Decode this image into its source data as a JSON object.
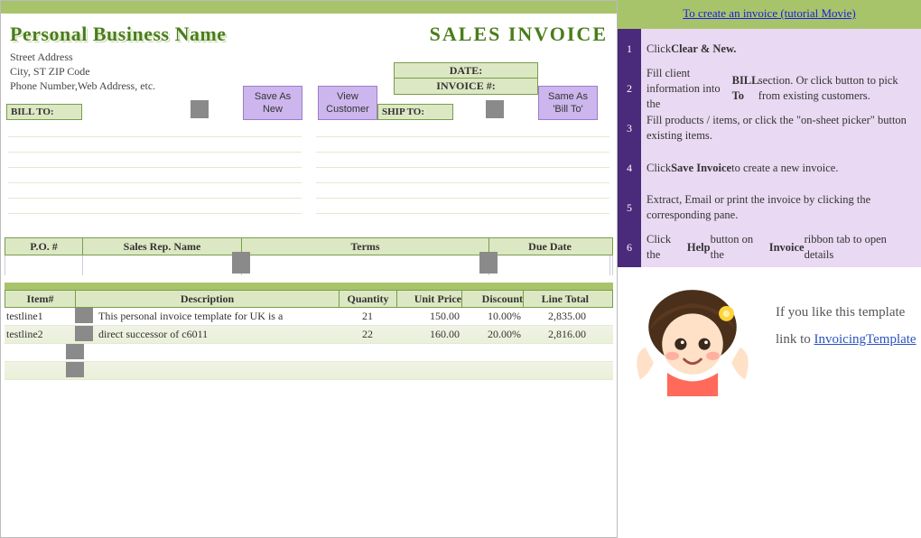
{
  "header": {
    "business_name": "Personal Business Name",
    "invoice_title": "SALES INVOICE",
    "addr_line1": "Street Address",
    "addr_line2": "City, ST  ZIP Code",
    "addr_line3": "Phone Number,Web Address, etc.",
    "date_label": "DATE:",
    "invoiceno_label": "INVOICE #:"
  },
  "buttons": {
    "save_as_new": "Save As\nNew",
    "view_customer": "View\nCustomer",
    "same_as_billto": "Same As\n'Bill To'"
  },
  "sections": {
    "bill_to": "BILL TO:",
    "ship_to": "SHIP TO:"
  },
  "po": {
    "c1": "P.O. #",
    "c2": "Sales Rep. Name",
    "c3": "Terms",
    "c4": "Due Date"
  },
  "items_header": {
    "item": "Item#",
    "desc": "Description",
    "qty": "Quantity",
    "price": "Unit Price",
    "disc": "Discount",
    "total": "Line Total"
  },
  "items": [
    {
      "item": "testline1",
      "desc": "This personal invoice template for UK is a",
      "qty": "21",
      "price": "150.00",
      "disc": "10.00%",
      "total": "2,835.00"
    },
    {
      "item": "testline2",
      "desc": "direct successor of c6011",
      "qty": "22",
      "price": "160.00",
      "disc": "20.00%",
      "total": "2,816.00"
    }
  ],
  "side": {
    "tutorial_link": "To create an invoice (tutorial Movie)",
    "tips": [
      {
        "n": "1",
        "html": "Click <b>Clear & New.</b>"
      },
      {
        "n": "2",
        "html": "Fill client information into the <b>BILL To</b> section. Or click button to pick from existing customers."
      },
      {
        "n": "3",
        "html": "Fill products / items, or click the \"on-sheet picker\" button existing items."
      },
      {
        "n": "4",
        "html": "Click <b>Save Invoice</b> to create a new invoice."
      },
      {
        "n": "5",
        "html": "Extract, Email or print the invoice by clicking the corresponding pane."
      },
      {
        "n": "6",
        "html": "Click the <b>Help</b> button on the <b>Invoice</b> ribbon tab to open details"
      }
    ],
    "footer_line1": "If you like this template",
    "footer_line2_prefix": "link to ",
    "footer_link": "InvoicingTemplate"
  }
}
